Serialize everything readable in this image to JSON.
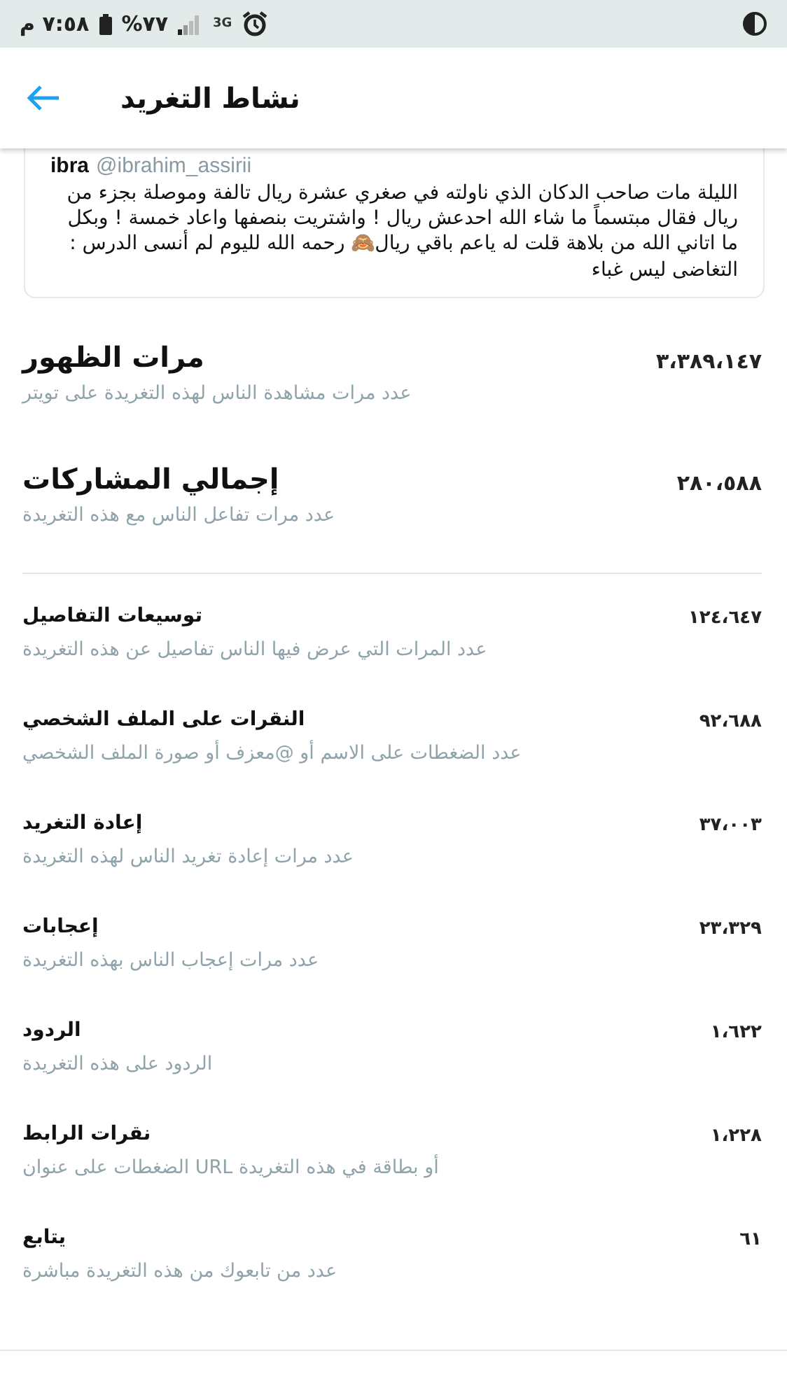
{
  "status_bar": {
    "time": "٧:٥٨ م",
    "battery": "%٧٧",
    "network": "3G"
  },
  "header": {
    "title": "نشاط التغريد"
  },
  "tweet": {
    "name": "ibra",
    "handle": "@ibrahim_assirii",
    "text": "الليلة مات صاحب الدكان الذي ناولته في صغري عشرة ريال تالفة وموصلة بجزء من ريال فقال مبتسماً ما شاء الله احدعش ريال ! واشتريت بنصفها واعاد خمسة ! وبكل ما اتاني الله من بلاهة قلت له ياعم باقي ريال🙈 رحمه الله لليوم لم أنسى الدرس : التغاضى ليس غباء"
  },
  "metrics": [
    {
      "kind": "major",
      "label": "مرات الظهور",
      "description": "عدد مرات مشاهدة الناس لهذه التغريدة على تويتر",
      "value": "٣،٣٨٩،١٤٧"
    },
    {
      "kind": "major",
      "label": "إجمالي المشاركات",
      "description": "عدد مرات تفاعل الناس مع هذه التغريدة",
      "value": "٢٨٠،٥٨٨"
    },
    {
      "kind": "minor",
      "label": "توسيعات التفاصيل",
      "description": "عدد المرات التي عرض فيها الناس تفاصيل عن هذه التغريدة",
      "value": "١٢٤،٦٤٧"
    },
    {
      "kind": "minor",
      "label": "النقرات على الملف الشخصي",
      "description": "عدد الضغطات على الاسم أو @معزف أو صورة الملف الشخصي",
      "value": "٩٢،٦٨٨"
    },
    {
      "kind": "minor",
      "label": "إعادة التغريد",
      "description": "عدد مرات إعادة تغريد الناس لهذه التغريدة",
      "value": "٣٧،٠٠٣"
    },
    {
      "kind": "minor",
      "label": "إعجابات",
      "description": "عدد مرات إعجاب الناس بهذه التغريدة",
      "value": "٢٣،٣٢٩"
    },
    {
      "kind": "minor",
      "label": "الردود",
      "description": "الردود على هذه التغريدة",
      "value": "١،٦٢٢"
    },
    {
      "kind": "minor",
      "label": "نقرات الرابط",
      "description": "الضغطات على عنوان URL أو بطاقة في هذه التغريدة",
      "value": "١،٢٢٨"
    },
    {
      "kind": "minor",
      "label": "يتابع",
      "description": "عدد من تابعوك من هذه التغريدة مباشرة",
      "value": "٦١"
    }
  ]
}
